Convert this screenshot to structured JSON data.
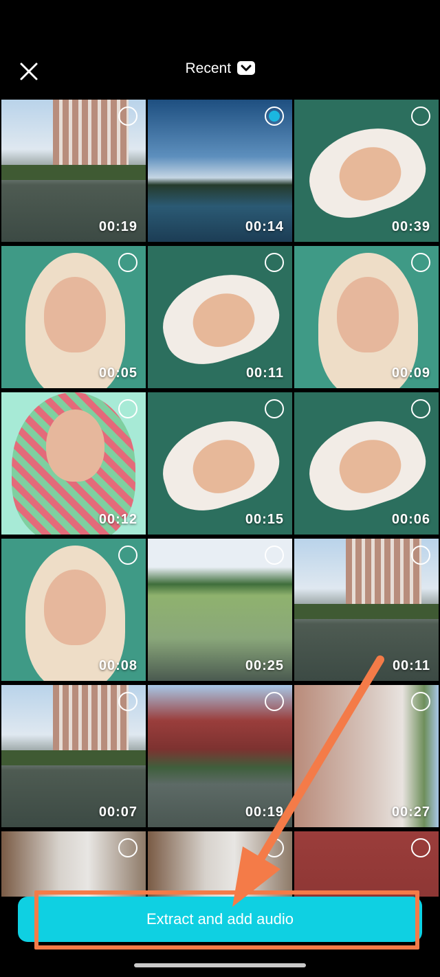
{
  "header": {
    "title": "Recent",
    "close_icon": "close-icon",
    "dropdown_icon": "chevron-down-icon"
  },
  "tiles": [
    {
      "duration": "00:19",
      "selected": false,
      "scene": "building-pond"
    },
    {
      "duration": "00:14",
      "selected": true,
      "scene": "sky-lake"
    },
    {
      "duration": "00:39",
      "selected": false,
      "scene": "portrait-tilted"
    },
    {
      "duration": "00:05",
      "selected": false,
      "scene": "portrait"
    },
    {
      "duration": "00:11",
      "selected": false,
      "scene": "portrait-tilted"
    },
    {
      "duration": "00:09",
      "selected": false,
      "scene": "portrait"
    },
    {
      "duration": "00:12",
      "selected": false,
      "scene": "portrait-check"
    },
    {
      "duration": "00:15",
      "selected": false,
      "scene": "portrait-tilted"
    },
    {
      "duration": "00:06",
      "selected": false,
      "scene": "portrait-tilted"
    },
    {
      "duration": "00:08",
      "selected": false,
      "scene": "portrait"
    },
    {
      "duration": "00:25",
      "selected": false,
      "scene": "rice-field"
    },
    {
      "duration": "00:11",
      "selected": false,
      "scene": "building-pond"
    },
    {
      "duration": "00:07",
      "selected": false,
      "scene": "building-pond"
    },
    {
      "duration": "00:19",
      "selected": false,
      "scene": "red-building-pond"
    },
    {
      "duration": "00:27",
      "selected": false,
      "scene": "brick-wall"
    },
    {
      "duration": "",
      "selected": false,
      "scene": "corridor"
    },
    {
      "duration": "",
      "selected": false,
      "scene": "corridor"
    },
    {
      "duration": "",
      "selected": false,
      "scene": "red-wall"
    }
  ],
  "cta": {
    "label": "Extract and add audio"
  },
  "colors": {
    "accent": "#0fd0e2",
    "annotation": "#f47b48",
    "selected_dot": "#1bb7e0"
  }
}
